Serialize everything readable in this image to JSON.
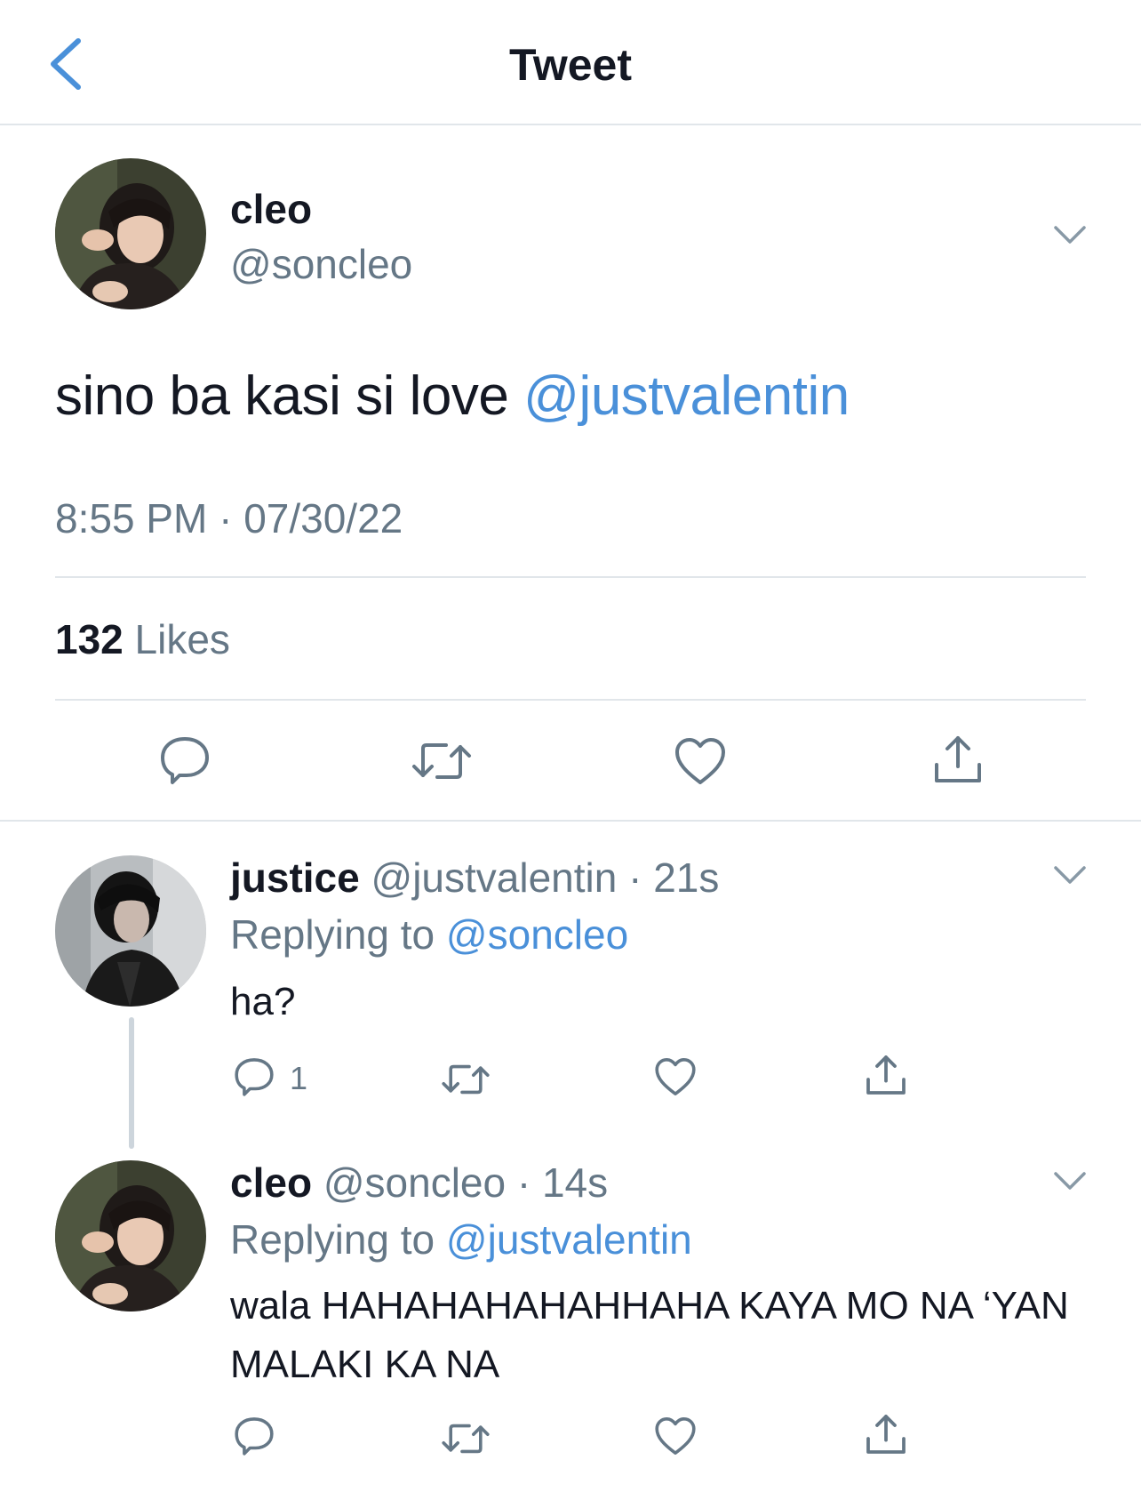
{
  "header": {
    "title": "Tweet",
    "back_icon": "chevron-left-icon"
  },
  "main_tweet": {
    "name": "cleo",
    "handle": "@soncleo",
    "text_plain": "sino ba kasi si love ",
    "text_mention": "@justvalentin",
    "timestamp": "8:55 PM · 07/30/22",
    "likes_count": "132",
    "likes_label": " Likes"
  },
  "replies": [
    {
      "name": "justice",
      "meta": " @justvalentin · 21s",
      "replying_prefix": "Replying to ",
      "replying_mention": "@soncleo",
      "text": "ha?",
      "reply_count": "1"
    },
    {
      "name": "cleo",
      "meta": " @soncleo · 14s",
      "replying_prefix": "Replying to ",
      "replying_mention": "@justvalentin",
      "text": "wala HAHAHAHAHAHHAHA KAYA MO NA ‘YAN MALAKI KA NA",
      "reply_count": ""
    }
  ],
  "colors": {
    "accent": "#4a90d9",
    "muted": "#657786",
    "divider": "#e1e6ea"
  }
}
